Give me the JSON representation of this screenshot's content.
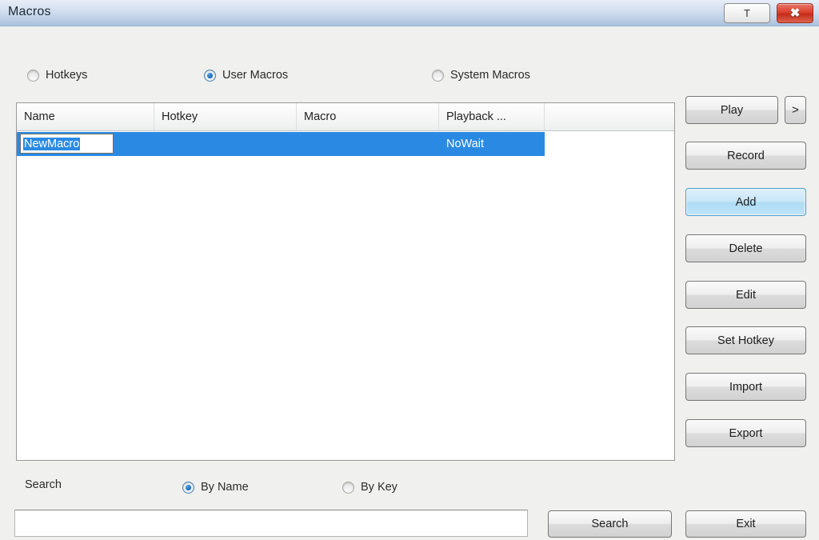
{
  "window": {
    "title": "Macros",
    "title_buttons": [
      {
        "name": "text-mode-button",
        "label": "T"
      },
      {
        "name": "close-button",
        "label": "✖"
      }
    ]
  },
  "mode_radios": [
    {
      "label": "Hotkeys",
      "checked": false
    },
    {
      "label": "User Macros",
      "checked": true
    },
    {
      "label": "System Macros",
      "checked": false
    }
  ],
  "list": {
    "columns": [
      "Name",
      "Hotkey",
      "Macro",
      "Playback ..."
    ],
    "rows": [
      {
        "name": "NewMacro",
        "name_editing": true,
        "hotkey": "",
        "macro": "",
        "playback": "NoWait",
        "selected": true
      }
    ]
  },
  "side_buttons": {
    "play": "Play",
    "next": ">",
    "record": "Record",
    "add": "Add",
    "delete": "Delete",
    "edit": "Edit",
    "set_hotkey": "Set Hotkey",
    "import": "Import",
    "export": "Export"
  },
  "search": {
    "label": "Search",
    "radios": [
      {
        "label": "By Name",
        "checked": true
      },
      {
        "label": "By Key",
        "checked": false
      }
    ],
    "input_value": "",
    "input_placeholder": "",
    "search_button": "Search",
    "exit_button": "Exit"
  },
  "colors": {
    "selection_blue": "#2a8ae3",
    "titlebar_blue": "#bdcfe6",
    "close_red": "#d9412c",
    "focus_blue": "#aedcf6",
    "body_gray": "#f0f0ee"
  }
}
